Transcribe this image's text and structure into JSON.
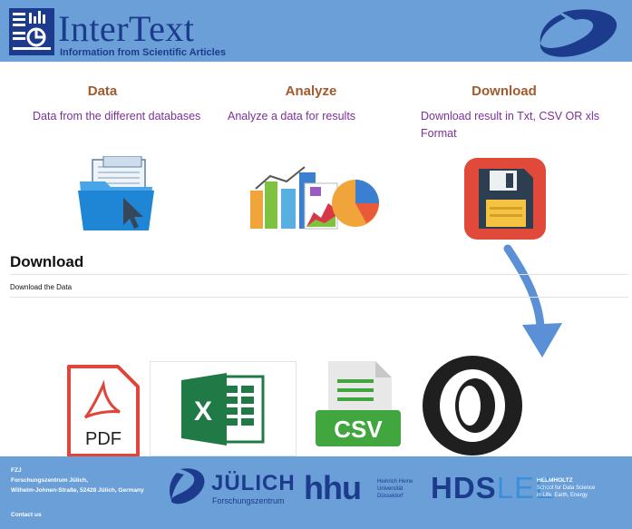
{
  "header": {
    "title": "InterText",
    "subtitle": "Information from Scientific Articles"
  },
  "features": [
    {
      "title": "Data",
      "description": "Data from the different databases",
      "icon": "folder-cursor-icon"
    },
    {
      "title": "Analyze",
      "description": "Analyze a data for results",
      "icon": "charts-icon"
    },
    {
      "title": "Download",
      "description": "Download result in Txt, CSV OR xls Format",
      "icon": "floppy-disk-icon"
    }
  ],
  "download_section": {
    "heading": "Download",
    "text": "Download the Data",
    "formats": [
      {
        "name": "PDF",
        "label": "PDF",
        "icon": "pdf-icon"
      },
      {
        "name": "Excel",
        "label": "X",
        "icon": "excel-icon"
      },
      {
        "name": "CSV",
        "label": "CSV",
        "icon": "csv-icon"
      },
      {
        "name": "JSON",
        "icon": "json-icon"
      }
    ]
  },
  "footer": {
    "org": "FZJ",
    "name": "Forschungszentrum Jülich,",
    "address": "Wilhelm-Johnen-Straße, 52428 Jülich, Germany",
    "contact": "Contact us",
    "partners": {
      "julich": "JÜLICH",
      "julich_sub": "Forschungszentrum",
      "hhu": "hhu",
      "hhu_sub1": "Heinrich Heine",
      "hhu_sub2": "Universität",
      "hhu_sub3": "Düsseldorf",
      "hds": "HDS",
      "lee": "LEE",
      "helm1": "HELMHOLTZ",
      "helm2": "School for Data Science",
      "helm3": "in Life, Earth, Energy"
    }
  },
  "colors": {
    "header_bg": "#6a9fd8",
    "brand_navy": "#1d3b8c",
    "feature_title": "#a15a2e",
    "feature_desc": "#7d2f9a",
    "arrow": "#5b8fd6"
  }
}
